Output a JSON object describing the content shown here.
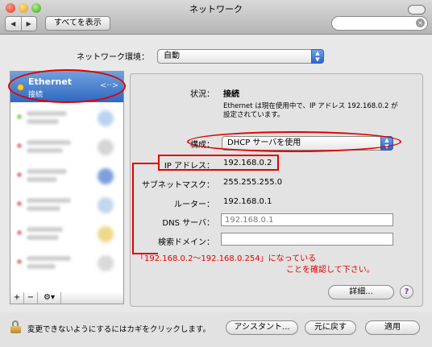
{
  "window": {
    "title": "ネットワーク"
  },
  "toolbar": {
    "show_all": "すべてを表示",
    "back_glyph": "◀",
    "forward_glyph": "▶"
  },
  "environment": {
    "label": "ネットワーク環境：",
    "value": "自動"
  },
  "sidebar": {
    "selected": {
      "name": "Ethernet",
      "status": "接続",
      "icon": "ethernet-arrows-icon"
    },
    "footer": {
      "add": "+",
      "remove": "−",
      "gear": "⚙▾"
    }
  },
  "status": {
    "label": "状況：",
    "value": "接続",
    "description_line1": "Ethernet は現在使用中で、IP アドレス 192.168.0.2 が",
    "description_line2": "設定されています。"
  },
  "config": {
    "label": "構成：",
    "value": "DHCP サーバを使用"
  },
  "ip": {
    "label": "IP アドレス：",
    "value": "192.168.0.2"
  },
  "subnet": {
    "label": "サブネットマスク：",
    "value": "255.255.255.0"
  },
  "router": {
    "label": "ルーター：",
    "value": "192.168.0.1"
  },
  "dns": {
    "label": "DNS サーバ：",
    "value": "192.168.0.1"
  },
  "search_domain": {
    "label": "検索ドメイン：",
    "value": ""
  },
  "annotation": {
    "line1": "「192.168.0.2～192.168.0.254」になっている",
    "line2": "ことを確認して下さい。"
  },
  "buttons": {
    "advanced": "詳細...",
    "help": "?",
    "assistant": "アシスタント...",
    "revert": "元に戻す",
    "apply": "適用"
  },
  "lock_text": "変更できないようにするにはカギをクリックします。"
}
